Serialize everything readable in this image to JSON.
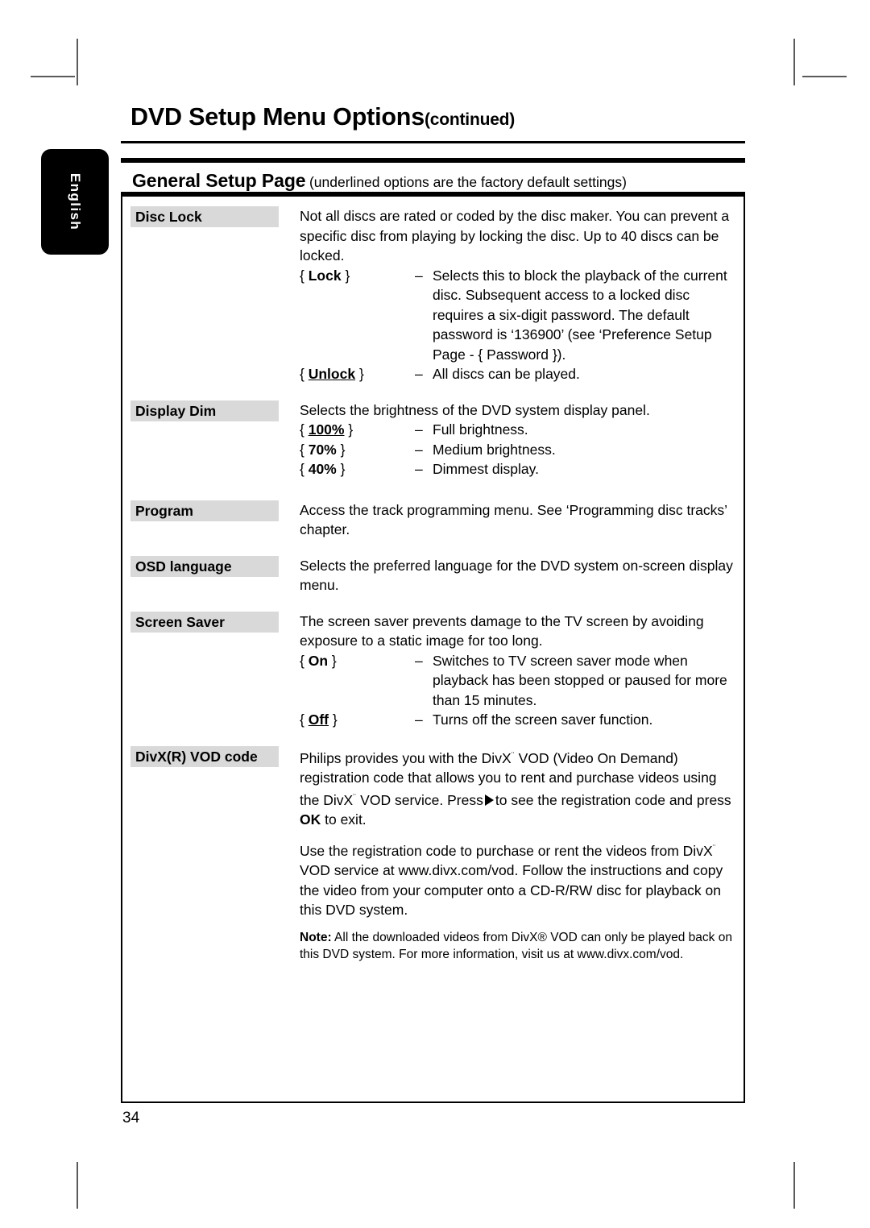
{
  "sidebar": {
    "language_tab": "English"
  },
  "header": {
    "title": "DVD Setup Menu Options",
    "title_suffix": "(continued)"
  },
  "banner": {
    "title": "General Setup Page",
    "subtitle": "(underlined options are the factory default settings)"
  },
  "rows": [
    {
      "label": "Disc Lock",
      "intro": "Not all discs are rated or coded by the disc maker.  You can prevent a specific disc from playing by locking the disc.  Up to 40 discs can be locked.",
      "options": [
        {
          "key": "{ Lock }",
          "key_text": "Lock",
          "underlined": false,
          "dash": "–",
          "desc": "Selects this to block the playback of the current disc.  Subsequent access to a locked disc requires a six-digit password.  The default password is ‘136900’ (see ‘Preference Setup Page - { Password })."
        },
        {
          "key": "{ Unlock }",
          "key_text": "Unlock",
          "underlined": true,
          "dash": "–",
          "desc": "All discs can be played."
        }
      ]
    },
    {
      "label": "Display Dim",
      "intro": "Selects the brightness of the DVD system display panel.",
      "options": [
        {
          "key": "{ 100% }",
          "key_text": "100%",
          "underlined": true,
          "dash": "–",
          "desc": "Full brightness."
        },
        {
          "key": "{ 70% }",
          "key_text": "70%",
          "underlined": false,
          "dash": "–",
          "desc": "Medium brightness."
        },
        {
          "key": "{ 40% }",
          "key_text": "40%",
          "underlined": false,
          "dash": "–",
          "desc": "Dimmest display."
        }
      ]
    },
    {
      "label": "Program",
      "intro": "Access the track programming menu.  See ‘Programming disc tracks’ chapter.",
      "options": []
    },
    {
      "label": "OSD language",
      "intro": "Selects the preferred language for the DVD system on-screen display menu.",
      "options": []
    },
    {
      "label": "Screen Saver",
      "intro": "The screen saver prevents damage to the TV screen by avoiding exposure to a static image for too long.",
      "options": [
        {
          "key": "{ On }",
          "key_text": "On",
          "underlined": false,
          "dash": "–",
          "desc": "Switches to TV screen saver mode when playback has been stopped or paused for more than 15 minutes."
        },
        {
          "key": "{ Off }",
          "key_text": "Off",
          "underlined": true,
          "dash": "–",
          "desc": "Turns off the screen saver function."
        }
      ]
    },
    {
      "label": "DivX(R) VOD code",
      "intro": "",
      "options": []
    }
  ],
  "divx": {
    "para1_a": "Philips provides you with the DivX",
    "para1_tm": "¨",
    "para1_b": " VOD (Video On Demand) registration code that allows you to rent and purchase videos using the DivX",
    "para1_c": " VOD service.  Press",
    "para1_d": "to see the registration code and press ",
    "para1_ok": "OK",
    "para1_e": " to exit.",
    "para2_a": "Use the registration code to purchase or rent the videos from DivX",
    "para2_b": " VOD service at www.divx.com/vod.  Follow the instructions and copy the video from your computer onto a CD-R/RW disc for playback on this DVD system.",
    "note_label": "Note:",
    "note_text": " All the downloaded videos from DivX® VOD can only be played back on this DVD system.  For more information, visit us at www.divx.com/vod."
  },
  "footer": {
    "page_number": "34"
  },
  "icons": {
    "play_arrow": "play-right-triangle"
  },
  "colors": {
    "label_background": "#d9d9d9",
    "text": "#000000",
    "page_background": "#ffffff",
    "tab_background": "#000000"
  }
}
